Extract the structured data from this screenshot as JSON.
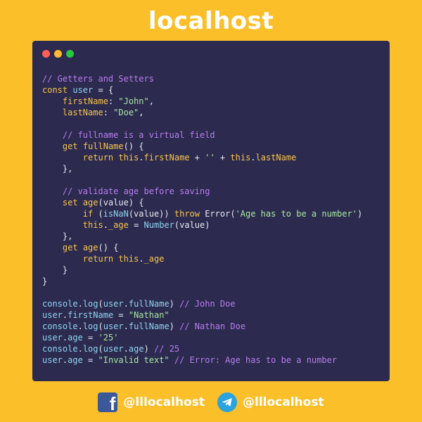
{
  "header": {
    "title": "localhost"
  },
  "window": {
    "dots": [
      "red",
      "yellow",
      "green"
    ],
    "lines": [
      [
        [
          "comment",
          "// Getters and Setters"
        ]
      ],
      [
        [
          "kw",
          "const"
        ],
        [
          "plain",
          " "
        ],
        [
          "fn",
          "user"
        ],
        [
          "plain",
          " = {"
        ]
      ],
      [
        [
          "plain",
          "    "
        ],
        [
          "kw",
          "firstName"
        ],
        [
          "plain",
          ": "
        ],
        [
          "str",
          "\"John\""
        ],
        [
          "plain",
          ","
        ]
      ],
      [
        [
          "plain",
          "    "
        ],
        [
          "kw",
          "lastName"
        ],
        [
          "plain",
          ": "
        ],
        [
          "str",
          "\"Doe\""
        ],
        [
          "plain",
          ","
        ]
      ],
      [
        [
          "plain",
          ""
        ]
      ],
      [
        [
          "plain",
          "    "
        ],
        [
          "comment",
          "// fullname is a virtual field"
        ]
      ],
      [
        [
          "plain",
          "    "
        ],
        [
          "kw",
          "get"
        ],
        [
          "plain",
          " "
        ],
        [
          "kw",
          "fullName"
        ],
        [
          "plain",
          "() {"
        ]
      ],
      [
        [
          "plain",
          "        "
        ],
        [
          "kw",
          "return"
        ],
        [
          "plain",
          " "
        ],
        [
          "kw",
          "this"
        ],
        [
          "plain",
          "."
        ],
        [
          "kw",
          "firstName"
        ],
        [
          "plain",
          " + "
        ],
        [
          "str",
          "''"
        ],
        [
          "plain",
          " + "
        ],
        [
          "kw",
          "this"
        ],
        [
          "plain",
          "."
        ],
        [
          "kw",
          "lastName"
        ]
      ],
      [
        [
          "plain",
          "    },"
        ]
      ],
      [
        [
          "plain",
          ""
        ]
      ],
      [
        [
          "plain",
          "    "
        ],
        [
          "comment",
          "// validate age before saving"
        ]
      ],
      [
        [
          "plain",
          "    "
        ],
        [
          "kw",
          "set"
        ],
        [
          "plain",
          " "
        ],
        [
          "kw",
          "age"
        ],
        [
          "plain",
          "("
        ],
        [
          "plain",
          "value"
        ],
        [
          "plain",
          ") {"
        ]
      ],
      [
        [
          "plain",
          "        "
        ],
        [
          "kw",
          "if"
        ],
        [
          "plain",
          " ("
        ],
        [
          "fn",
          "isNaN"
        ],
        [
          "plain",
          "(value)) "
        ],
        [
          "kw",
          "throw"
        ],
        [
          "plain",
          " Error("
        ],
        [
          "str",
          "'Age has to be a number'"
        ],
        [
          "plain",
          ")"
        ]
      ],
      [
        [
          "plain",
          "        "
        ],
        [
          "kw",
          "this"
        ],
        [
          "plain",
          "."
        ],
        [
          "kw",
          "_age"
        ],
        [
          "plain",
          " = "
        ],
        [
          "fn",
          "Number"
        ],
        [
          "plain",
          "(value)"
        ]
      ],
      [
        [
          "plain",
          "    },"
        ]
      ],
      [
        [
          "plain",
          "    "
        ],
        [
          "kw",
          "get"
        ],
        [
          "plain",
          " "
        ],
        [
          "kw",
          "age"
        ],
        [
          "plain",
          "() {"
        ]
      ],
      [
        [
          "plain",
          "        "
        ],
        [
          "kw",
          "return"
        ],
        [
          "plain",
          " "
        ],
        [
          "kw",
          "this"
        ],
        [
          "plain",
          "."
        ],
        [
          "kw",
          "_age"
        ]
      ],
      [
        [
          "plain",
          "    }"
        ]
      ],
      [
        [
          "plain",
          "}"
        ]
      ],
      [
        [
          "plain",
          ""
        ]
      ],
      [
        [
          "fn",
          "console"
        ],
        [
          "plain",
          "."
        ],
        [
          "fn",
          "log"
        ],
        [
          "plain",
          "("
        ],
        [
          "fn",
          "user"
        ],
        [
          "plain",
          "."
        ],
        [
          "fn",
          "fullName"
        ],
        [
          "plain",
          ") "
        ],
        [
          "comment",
          "// John Doe"
        ]
      ],
      [
        [
          "fn",
          "user"
        ],
        [
          "plain",
          "."
        ],
        [
          "fn",
          "firstName"
        ],
        [
          "plain",
          " = "
        ],
        [
          "str",
          "\"Nathan\""
        ]
      ],
      [
        [
          "fn",
          "console"
        ],
        [
          "plain",
          "."
        ],
        [
          "fn",
          "log"
        ],
        [
          "plain",
          "("
        ],
        [
          "fn",
          "user"
        ],
        [
          "plain",
          "."
        ],
        [
          "fn",
          "fullName"
        ],
        [
          "plain",
          ") "
        ],
        [
          "comment",
          "// Nathan Doe"
        ]
      ],
      [
        [
          "fn",
          "user"
        ],
        [
          "plain",
          "."
        ],
        [
          "fn",
          "age"
        ],
        [
          "plain",
          " = "
        ],
        [
          "str",
          "'25'"
        ]
      ],
      [
        [
          "fn",
          "console"
        ],
        [
          "plain",
          "."
        ],
        [
          "fn",
          "log"
        ],
        [
          "plain",
          "("
        ],
        [
          "fn",
          "user"
        ],
        [
          "plain",
          "."
        ],
        [
          "fn",
          "age"
        ],
        [
          "plain",
          ") "
        ],
        [
          "comment",
          "// 25"
        ]
      ],
      [
        [
          "fn",
          "user"
        ],
        [
          "plain",
          "."
        ],
        [
          "fn",
          "age"
        ],
        [
          "plain",
          " = "
        ],
        [
          "str",
          "\"Invalid text\""
        ],
        [
          "plain",
          " "
        ],
        [
          "comment",
          "// Error: Age has to be a number"
        ]
      ]
    ]
  },
  "footer": {
    "facebook": {
      "icon": "facebook-icon",
      "handle": "@lllocalhost"
    },
    "telegram": {
      "icon": "telegram-icon",
      "handle": "@lllocalhost"
    }
  },
  "colors": {
    "background": "#fbbf2a",
    "window": "#2c2b4f",
    "comment": "#b87cf0",
    "keyword": "#f8c34a",
    "identifier": "#8fd3f0",
    "string": "#a8e6a0"
  }
}
